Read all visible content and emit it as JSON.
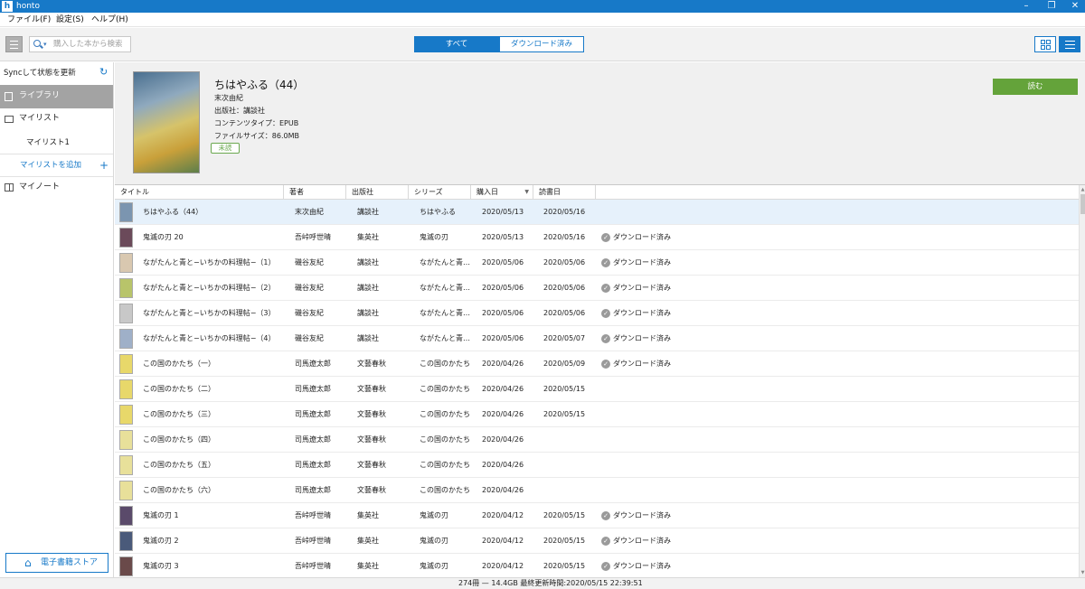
{
  "window": {
    "title": "honto",
    "app_icon_letter": "h"
  },
  "menu": [
    "ファイル(F)",
    "設定(S)",
    "ヘルプ(H)"
  ],
  "toolbar": {
    "search_placeholder": "購入した本から検索",
    "seg_all": "すべて",
    "seg_downloaded": "ダウンロード済み",
    "accent": "#1779c8"
  },
  "sidebar": {
    "sync_label": "Syncして状態を更新",
    "library": "ライブラリ",
    "mylist": "マイリスト",
    "mylist1": "マイリスト1",
    "add_mylist": "マイリストを追加",
    "mynote": "マイノート",
    "store": "電子書籍ストア"
  },
  "detail": {
    "title": "ちはやふる（44）",
    "author": "末次由紀",
    "publisher": "出版社：講談社",
    "content_type": "コンテンツタイプ：EPUB",
    "file_size": "ファイルサイズ：86.0MB",
    "badge": "未読",
    "read_button": "読む",
    "read_button_color": "#64a33a"
  },
  "table": {
    "headers": [
      "タイトル",
      "著者",
      "出版社",
      "シリーズ",
      "購入日",
      "読書日"
    ],
    "rows": [
      {
        "title": "ちはやふる（44）",
        "author": "末次由紀",
        "publisher": "講談社",
        "series": "ちはやふる",
        "purchase": "2020/05/13",
        "read": "2020/05/16",
        "status": "",
        "thumb": "#7b95b0"
      },
      {
        "title": "鬼滅の刃 20",
        "author": "吾峠呼世晴",
        "publisher": "集英社",
        "series": "鬼滅の刃",
        "purchase": "2020/05/13",
        "read": "2020/05/16",
        "status": "ダウンロード済み",
        "thumb": "#6b4a5a"
      },
      {
        "title": "ながたんと青と−いちかの料理帖−（1）",
        "author": "磯谷友紀",
        "publisher": "講談社",
        "series": "ながたんと青…",
        "purchase": "2020/05/06",
        "read": "2020/05/06",
        "status": "ダウンロード済み",
        "thumb": "#d9c8b0"
      },
      {
        "title": "ながたんと青と−いちかの料理帖−（2）",
        "author": "磯谷友紀",
        "publisher": "講談社",
        "series": "ながたんと青…",
        "purchase": "2020/05/06",
        "read": "2020/05/06",
        "status": "ダウンロード済み",
        "thumb": "#b8c46a"
      },
      {
        "title": "ながたんと青と−いちかの料理帖−（3）",
        "author": "磯谷友紀",
        "publisher": "講談社",
        "series": "ながたんと青…",
        "purchase": "2020/05/06",
        "read": "2020/05/06",
        "status": "ダウンロード済み",
        "thumb": "#c8c8c8"
      },
      {
        "title": "ながたんと青と−いちかの料理帖−（4）",
        "author": "磯谷友紀",
        "publisher": "講談社",
        "series": "ながたんと青…",
        "purchase": "2020/05/06",
        "read": "2020/05/07",
        "status": "ダウンロード済み",
        "thumb": "#9fb0c8"
      },
      {
        "title": "この国のかたち（一）",
        "author": "司馬遼太郎",
        "publisher": "文藝春秋",
        "series": "この国のかたち",
        "purchase": "2020/04/26",
        "read": "2020/05/09",
        "status": "ダウンロード済み",
        "thumb": "#e8d86a"
      },
      {
        "title": "この国のかたち（二）",
        "author": "司馬遼太郎",
        "publisher": "文藝春秋",
        "series": "この国のかたち",
        "purchase": "2020/04/26",
        "read": "2020/05/15",
        "status": "",
        "thumb": "#e8d86a"
      },
      {
        "title": "この国のかたち（三）",
        "author": "司馬遼太郎",
        "publisher": "文藝春秋",
        "series": "この国のかたち",
        "purchase": "2020/04/26",
        "read": "2020/05/15",
        "status": "",
        "thumb": "#e8d86a"
      },
      {
        "title": "この国のかたち（四）",
        "author": "司馬遼太郎",
        "publisher": "文藝春秋",
        "series": "この国のかたち",
        "purchase": "2020/04/26",
        "read": "",
        "status": "",
        "thumb": "#e8e09a"
      },
      {
        "title": "この国のかたち（五）",
        "author": "司馬遼太郎",
        "publisher": "文藝春秋",
        "series": "この国のかたち",
        "purchase": "2020/04/26",
        "read": "",
        "status": "",
        "thumb": "#e8e09a"
      },
      {
        "title": "この国のかたち（六）",
        "author": "司馬遼太郎",
        "publisher": "文藝春秋",
        "series": "この国のかたち",
        "purchase": "2020/04/26",
        "read": "",
        "status": "",
        "thumb": "#e8e09a"
      },
      {
        "title": "鬼滅の刃 1",
        "author": "吾峠呼世晴",
        "publisher": "集英社",
        "series": "鬼滅の刃",
        "purchase": "2020/04/12",
        "read": "2020/05/15",
        "status": "ダウンロード済み",
        "thumb": "#5a4a6a"
      },
      {
        "title": "鬼滅の刃 2",
        "author": "吾峠呼世晴",
        "publisher": "集英社",
        "series": "鬼滅の刃",
        "purchase": "2020/04/12",
        "read": "2020/05/15",
        "status": "ダウンロード済み",
        "thumb": "#4a5a7a"
      },
      {
        "title": "鬼滅の刃 3",
        "author": "吾峠呼世晴",
        "publisher": "集英社",
        "series": "鬼滅の刃",
        "purchase": "2020/04/12",
        "read": "2020/05/15",
        "status": "ダウンロード済み",
        "thumb": "#6a4a4a"
      }
    ]
  },
  "status": {
    "text": "274冊 — 14.4GB  最終更新時間:2020/05/15 22:39:51"
  }
}
